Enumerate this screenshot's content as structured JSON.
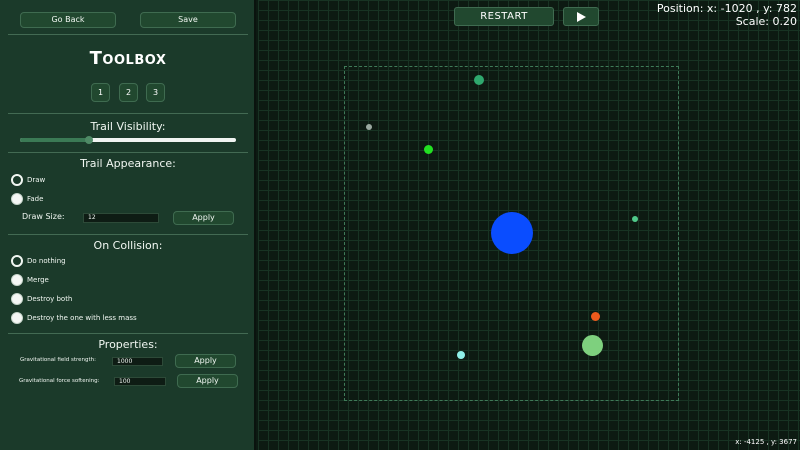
{
  "sidebar": {
    "go_back": "Go Back",
    "save": "Save",
    "title": "Toolbox",
    "tabs": [
      "1",
      "2",
      "3"
    ],
    "trail_visibility": {
      "label": "Trail Visibility:",
      "value_fraction": 0.32
    },
    "trail_appearance": {
      "heading": "Trail Appearance:",
      "options": [
        "Draw",
        "Fade"
      ],
      "selected": "Draw",
      "draw_size_label": "Draw Size:",
      "draw_size_value": "12",
      "apply": "Apply"
    },
    "on_collision": {
      "heading": "On Collision:",
      "options": [
        "Do nothing",
        "Merge",
        "Destroy both",
        "Destroy the one with less mass"
      ],
      "selected": "Do nothing"
    },
    "properties": {
      "heading": "Properties:",
      "field_strength_label": "Gravitational field strength:",
      "field_strength_value": "1000",
      "softening_label": "Gravitational force softening:",
      "softening_value": "100",
      "apply": "Apply"
    }
  },
  "canvas": {
    "restart": "RESTART",
    "play_icon": "play-icon",
    "position_readout": "Position: x: -1020 , y: 782",
    "scale_readout": "Scale: 0.20",
    "cursor_readout": "x: -4125 , y: 3677",
    "body_colors": {
      "central": "#0a4dff",
      "green_large": "#7ed07e",
      "teal": "#2fa86e",
      "bright_green": "#22e022",
      "grey": "#9aa8a0",
      "small_green": "#4fc98a",
      "orange": "#ee5a1c",
      "cyan": "#8ff0e8"
    }
  }
}
